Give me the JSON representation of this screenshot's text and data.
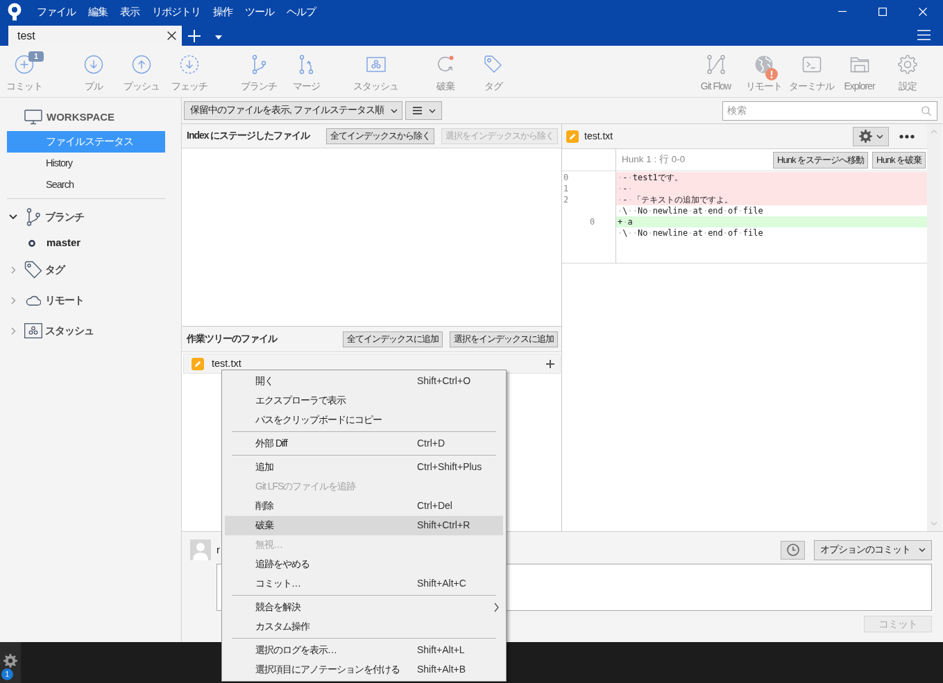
{
  "window": {
    "menu": [
      "ファイル",
      "編集",
      "表示",
      "リポジトリ",
      "操作",
      "ツール",
      "ヘルプ"
    ]
  },
  "tabs": [
    {
      "label": "test",
      "selected": true
    }
  ],
  "toolbar": {
    "left": [
      [
        {
          "kind": "commit",
          "label": "コミット",
          "badge": "1"
        }
      ],
      [
        {
          "kind": "pull",
          "label": "プル"
        },
        {
          "kind": "push",
          "label": "プッシュ"
        },
        {
          "kind": "fetch",
          "label": "フェッチ"
        }
      ],
      [
        {
          "kind": "branch",
          "label": "ブランチ"
        },
        {
          "kind": "merge",
          "label": "マージ"
        }
      ],
      [
        {
          "kind": "stash",
          "label": "スタッシュ"
        }
      ],
      [
        {
          "kind": "discard",
          "label": "破棄"
        },
        {
          "kind": "tag",
          "label": "タグ"
        }
      ]
    ],
    "right": [
      {
        "kind": "gitflow",
        "label": "Git Flow",
        "alert": false
      },
      {
        "kind": "remote",
        "label": "リモート",
        "alert": true
      },
      {
        "kind": "terminal",
        "label": "ターミナル",
        "alert": false
      },
      {
        "kind": "explorer",
        "label": "Explorer",
        "alert": false
      },
      {
        "kind": "settings",
        "label": "設定",
        "alert": false
      }
    ]
  },
  "sidebar": {
    "workspace": {
      "title": "WORKSPACE",
      "items": [
        {
          "label": "ファイルステータス",
          "selected": true
        },
        {
          "label": "History",
          "selected": false
        },
        {
          "label": "Search",
          "selected": false
        }
      ]
    },
    "tree": [
      {
        "kind": "branch",
        "label": "ブランチ",
        "expanded": true,
        "children": [
          {
            "label": "master",
            "current": true
          }
        ]
      },
      {
        "kind": "tag",
        "label": "タグ",
        "expanded": false
      },
      {
        "kind": "remote",
        "label": "リモート",
        "expanded": false
      },
      {
        "kind": "stash",
        "label": "スタッシュ",
        "expanded": false
      }
    ]
  },
  "filter_bar": {
    "view": "保留中のファイルを表示, ファイルステータス順",
    "search": {
      "placeholder": "検索"
    }
  },
  "staged": {
    "title": "Index にステージしたファイル",
    "buttons": [
      {
        "label": "全てインデックスから除く",
        "disabled": false
      },
      {
        "label": "選択をインデックスから除く",
        "disabled": true
      }
    ]
  },
  "unstaged": {
    "title": "作業ツリーのファイル",
    "buttons": [
      {
        "label": "全てインデックスに追加",
        "disabled": false
      },
      {
        "label": "選択をインデックスに追加",
        "disabled": false
      }
    ],
    "files": [
      {
        "name": "test.txt",
        "selected": true
      }
    ]
  },
  "diff": {
    "file": {
      "name": "test.txt"
    },
    "hunks": [
      {
        "title": "Hunk 1 : 行 0-0",
        "buttons": [
          "Hunk をステージへ移動",
          "Hunk を破棄"
        ],
        "lines": [
          {
            "kind": "removed",
            "old": "0",
            "text": "·-·test1です。"
          },
          {
            "kind": "removed",
            "old": "1",
            "text": "·-·"
          },
          {
            "kind": "removed",
            "old": "2",
            "text": "·-·「テキストの追加ですよ。"
          },
          {
            "kind": "context",
            "text": "·\\··No·newline·at·end·of·file"
          },
          {
            "kind": "added",
            "new": "0",
            "text": "+·a"
          },
          {
            "kind": "context",
            "text": "·\\··No·newline·at·end·of·file"
          }
        ]
      }
    ]
  },
  "commit": {
    "author": "r",
    "options": "オプションのコミット",
    "commit_button": {
      "label": "コミット",
      "disabled": true
    }
  },
  "context_menu": {
    "items": [
      {
        "kind": "item",
        "label": "開く",
        "shortcut": "Shift+Ctrl+O",
        "disabled": false,
        "selected": false
      },
      {
        "kind": "item",
        "label": "エクスプローラで表示",
        "disabled": false,
        "selected": false
      },
      {
        "kind": "item",
        "label": "パスをクリップボードにコピー",
        "disabled": false,
        "selected": false
      },
      {
        "kind": "separator"
      },
      {
        "kind": "item",
        "label": "外部 Diff",
        "shortcut": "Ctrl+D",
        "disabled": false,
        "selected": false
      },
      {
        "kind": "separator"
      },
      {
        "kind": "item",
        "label": "追加",
        "shortcut": "Ctrl+Shift+Plus",
        "disabled": false,
        "selected": false
      },
      {
        "kind": "item",
        "label": "Git LFSのファイルを追跡",
        "disabled": true,
        "selected": false
      },
      {
        "kind": "item",
        "label": "削除",
        "shortcut": "Ctrl+Del",
        "disabled": false,
        "selected": false
      },
      {
        "kind": "item",
        "label": "破棄",
        "shortcut": "Shift+Ctrl+R",
        "disabled": false,
        "selected": true
      },
      {
        "kind": "item",
        "label": "無視…",
        "disabled": true,
        "selected": false
      },
      {
        "kind": "item",
        "label": "追跡をやめる",
        "disabled": false,
        "selected": false
      },
      {
        "kind": "item",
        "label": "コミット…",
        "shortcut": "Shift+Alt+C",
        "disabled": false,
        "selected": false
      },
      {
        "kind": "separator"
      },
      {
        "kind": "submenu",
        "label": "競合を解決",
        "disabled": false,
        "selected": false
      },
      {
        "kind": "item",
        "label": "カスタム操作",
        "disabled": false,
        "selected": false
      },
      {
        "kind": "separator"
      },
      {
        "kind": "item",
        "label": "選択のログを表示…",
        "shortcut": "Shift+Alt+L",
        "disabled": false,
        "selected": false
      },
      {
        "kind": "item",
        "label": "選択項目にアノテーションを付ける",
        "shortcut": "Shift+Alt+B",
        "disabled": false,
        "selected": false
      }
    ]
  },
  "taskbar": {
    "badge": "1"
  }
}
